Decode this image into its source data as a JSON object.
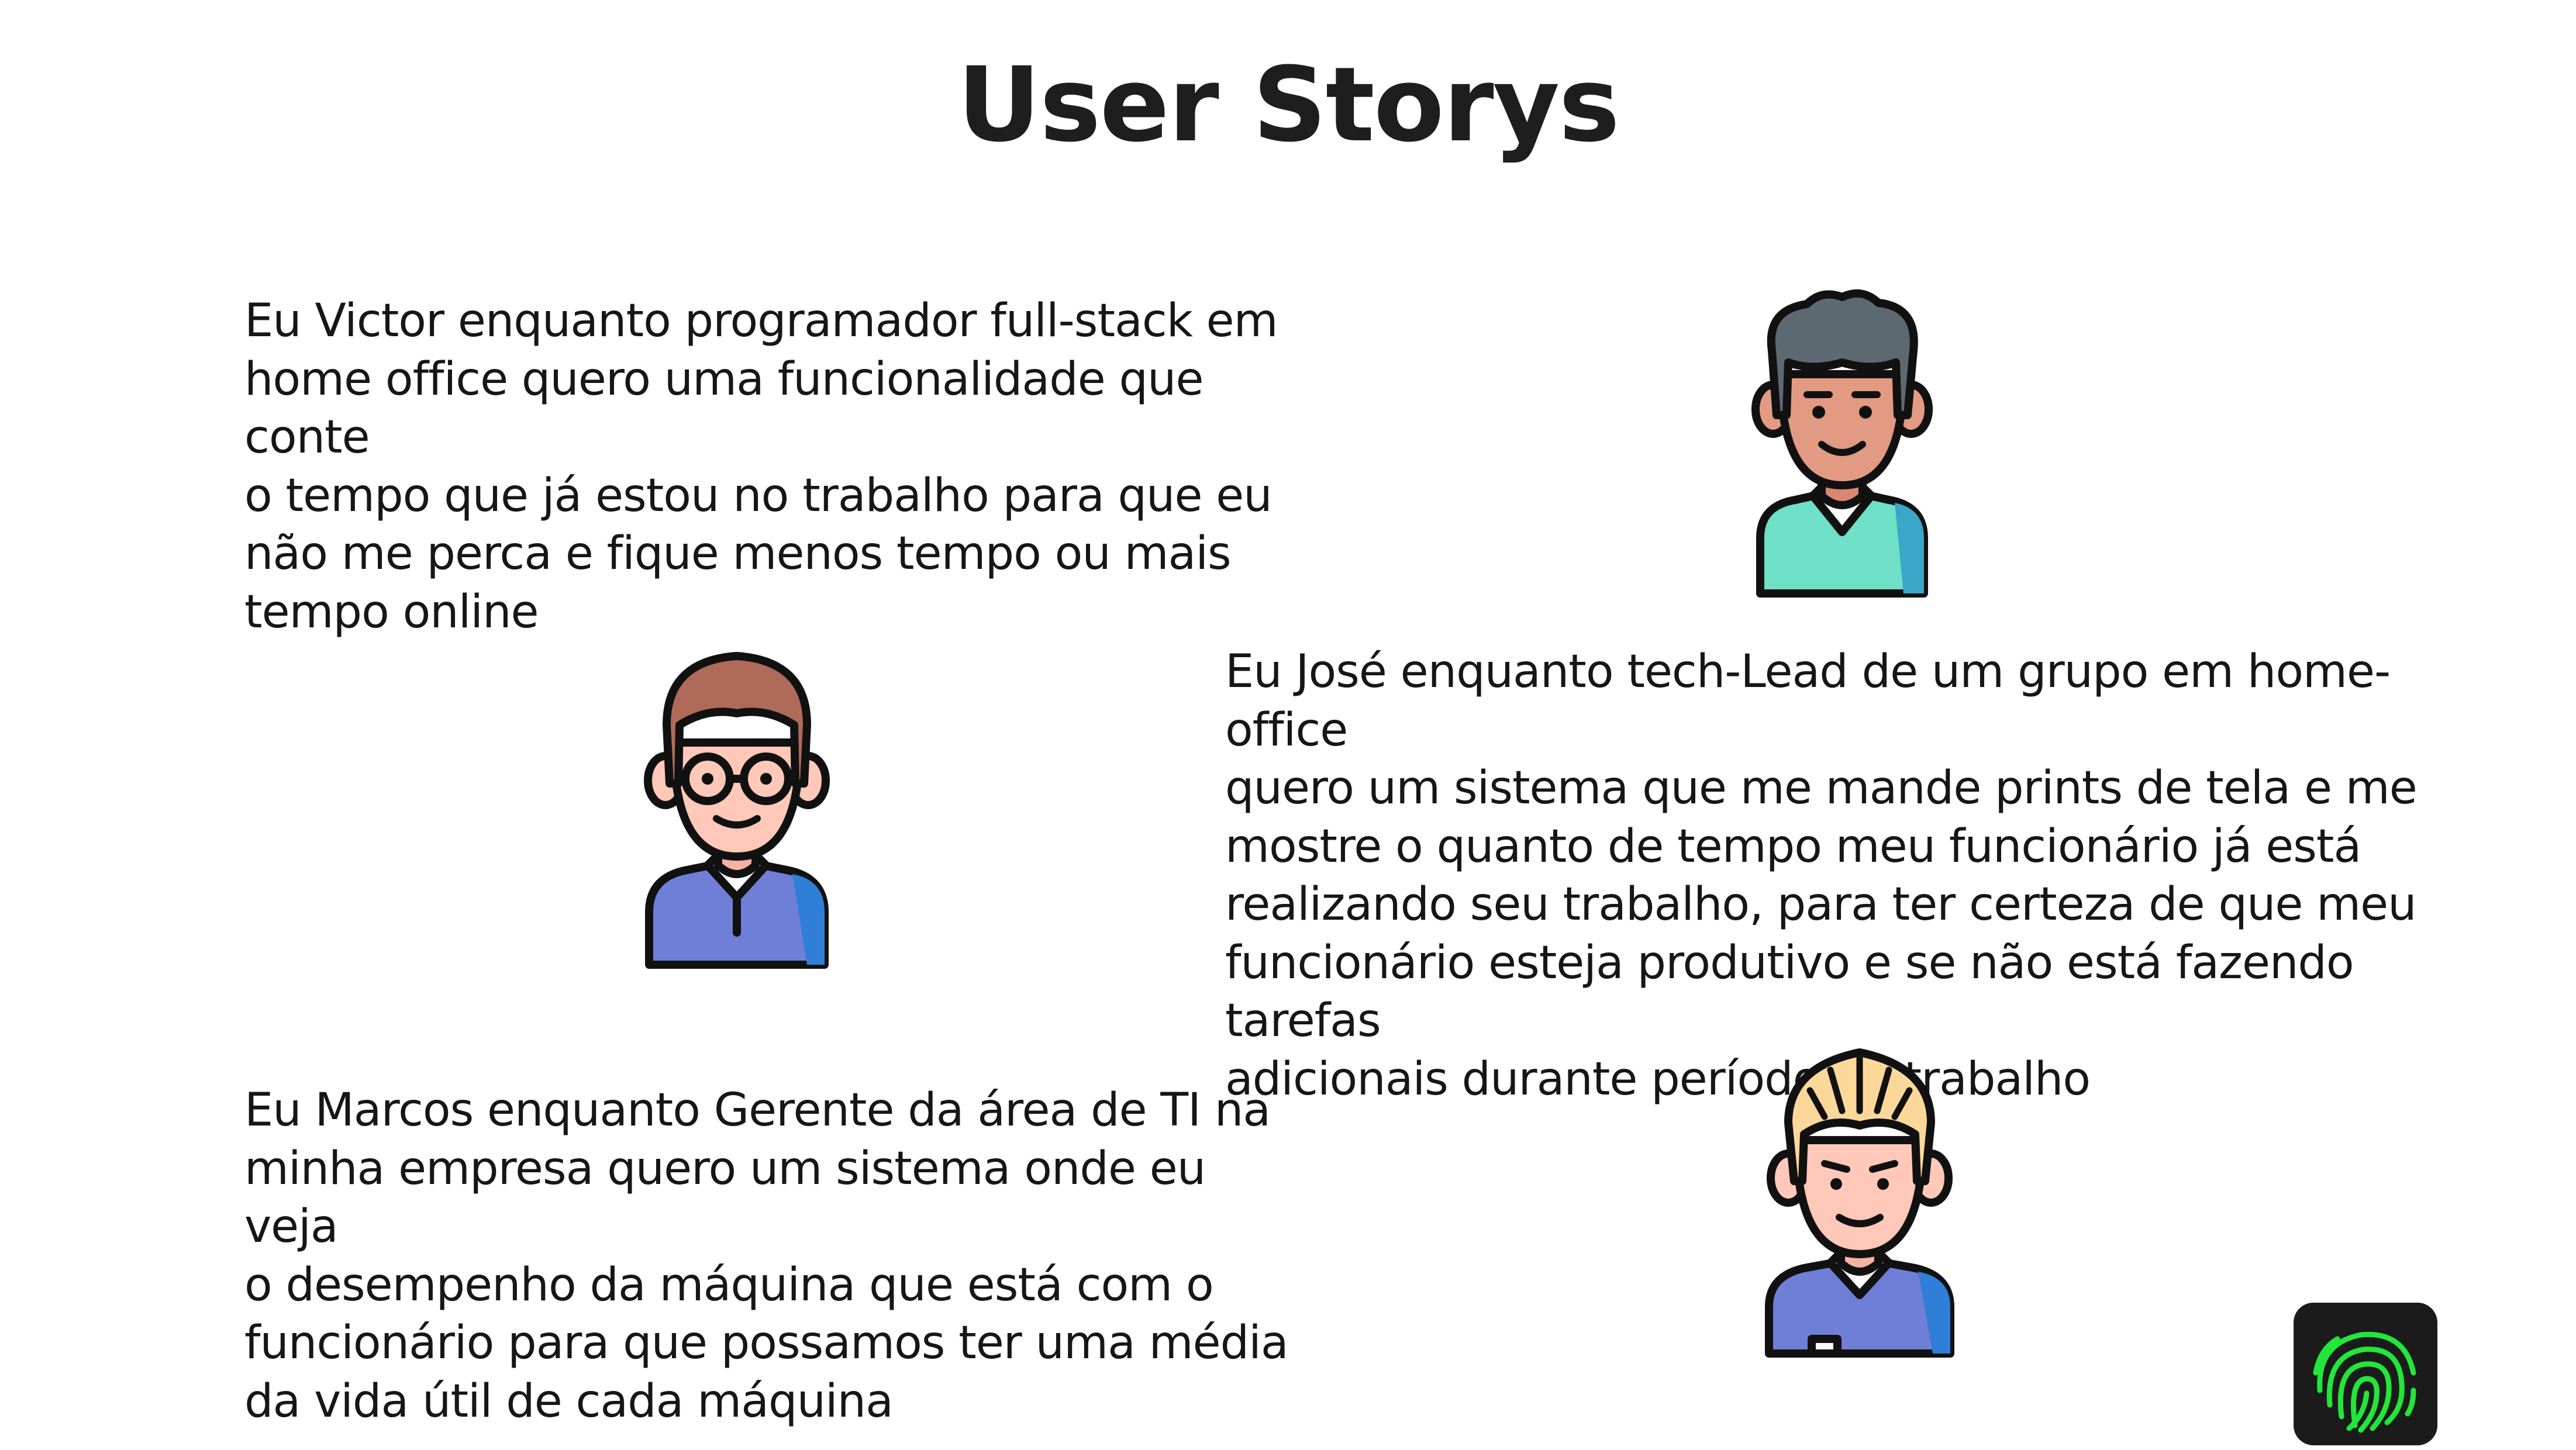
{
  "slide": {
    "title": "User Storys"
  },
  "stories": [
    {
      "person": "Victor",
      "text": "Eu Victor enquanto programador full-stack em\nhome office quero uma funcionalidade que conte\no tempo que já estou no trabalho para que eu\nnão me perca e fique menos tempo ou mais\ntempo online"
    },
    {
      "person": "José",
      "text": "Eu José enquanto tech-Lead de um grupo em home-office\nquero um sistema que me mande prints de tela e me\nmostre o quanto de tempo meu funcionário já está\nrealizando seu trabalho, para ter certeza de que meu\nfuncionário esteja produtivo e se não está fazendo tarefas\nadicionais durante período de trabalho"
    },
    {
      "person": "Marcos",
      "text": "Eu Marcos enquanto Gerente da área de TI na\nminha empresa quero um sistema onde eu veja\no desempenho da máquina que está com o\nfuncionário para que possamos ter uma média\nda vida útil de cada máquina"
    }
  ],
  "icons": {
    "avatar_victor": "avatar-dark-hair-icon",
    "avatar_jose": "avatar-glasses-icon",
    "avatar_marcos": "avatar-blond-hair-icon",
    "logo": "fingerprint-icon"
  },
  "colors": {
    "background": "#ffffff",
    "text": "#1e1e1e",
    "outline": "#111111",
    "skin": "#ffc8b8",
    "skin_tan": "#e39a82",
    "hair_dark": "#5d6970",
    "hair_brown": "#b06a5a",
    "hair_blond": "#fbd89a",
    "shirt_teal": "#6ee0c8",
    "shirt_blue": "#6f7fd8",
    "logo_bg": "#1b1b1b",
    "logo_green": "#22e63a"
  }
}
